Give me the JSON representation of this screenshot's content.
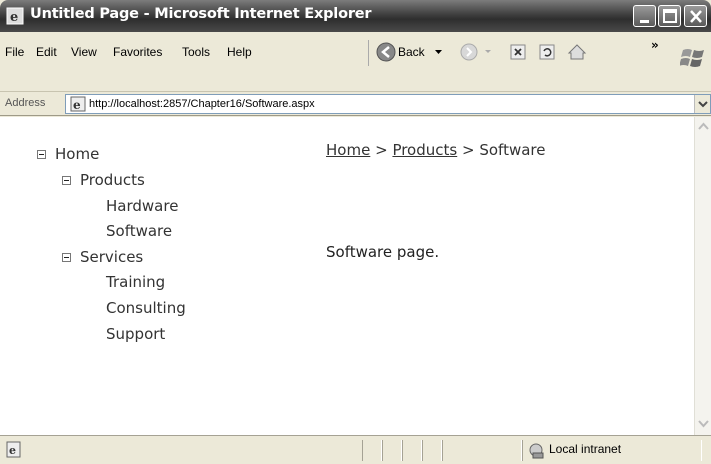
{
  "window": {
    "title": "Untitled Page - Microsoft Internet Explorer"
  },
  "menu": {
    "file": "File",
    "edit": "Edit",
    "view": "View",
    "favorites": "Favorites",
    "tools": "Tools",
    "help": "Help"
  },
  "toolbar": {
    "back_label": "Back",
    "more": "»"
  },
  "address": {
    "label": "Address",
    "url": "http://localhost:2857/Chapter16/Software.aspx"
  },
  "tree": {
    "home": "Home",
    "products": "Products",
    "hardware": "Hardware",
    "software": "Software",
    "services": "Services",
    "training": "Training",
    "consulting": "Consulting",
    "support": "Support"
  },
  "breadcrumb": {
    "home": "Home",
    "products": "Products",
    "current": "Software",
    "separator": ">"
  },
  "page": {
    "body_text": "Software page."
  },
  "status": {
    "zone": "Local intranet"
  }
}
